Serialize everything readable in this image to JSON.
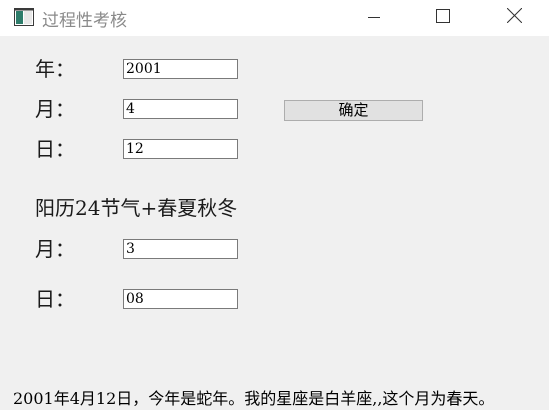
{
  "window": {
    "title": "过程性考核",
    "icon": "app-window-icon",
    "controls": {
      "minimize": "minimize-icon",
      "maximize": "maximize-icon",
      "close": "close-icon"
    }
  },
  "form": {
    "year_label": "年：",
    "year_value": "2001",
    "month_label": "月：",
    "month_value": "4",
    "day_label": "日：",
    "day_value": "12",
    "confirm_label": "确定"
  },
  "solar_terms": {
    "heading": "阳历24节气+春夏秋冬",
    "month_label": "月：",
    "month_value": "3",
    "day_label": "日：",
    "day_value": "08"
  },
  "result_text": "2001年4月12日，今年是蛇年。我的星座是白羊座,,这个月为春天。"
}
